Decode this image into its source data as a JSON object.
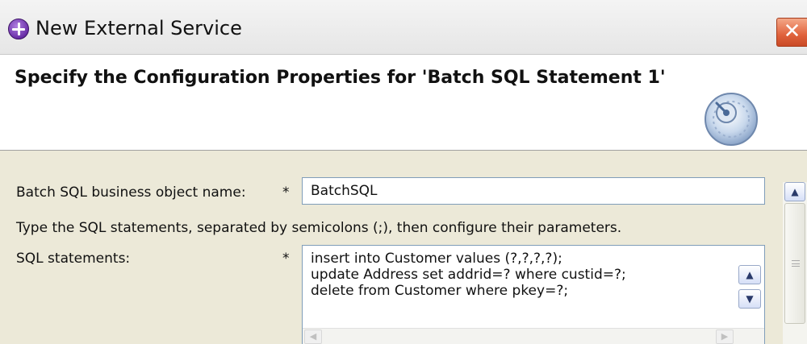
{
  "window": {
    "title": "New External Service",
    "close_symbol": "✕"
  },
  "header": {
    "title": "Specify the Configuration Properties for 'Batch SQL Statement 1'",
    "banner_icon": "wizard-dial-icon"
  },
  "form": {
    "bo_name_label": "Batch SQL business object name:",
    "bo_name_required": "*",
    "bo_name_value": "BatchSQL",
    "instructions": "Type the SQL statements, separated by semicolons (;), then configure their parameters.",
    "sql_label": "SQL statements:",
    "sql_required": "*",
    "sql_lines": [
      "insert into Customer values (?,?,?,?);",
      "update Address set addrid=? where custid=?;",
      "delete from Customer where pkey=?;"
    ]
  },
  "icons": {
    "scroll_up": "▲",
    "scroll_down": "▼",
    "scroll_left": "◀",
    "scroll_right": "▶"
  }
}
